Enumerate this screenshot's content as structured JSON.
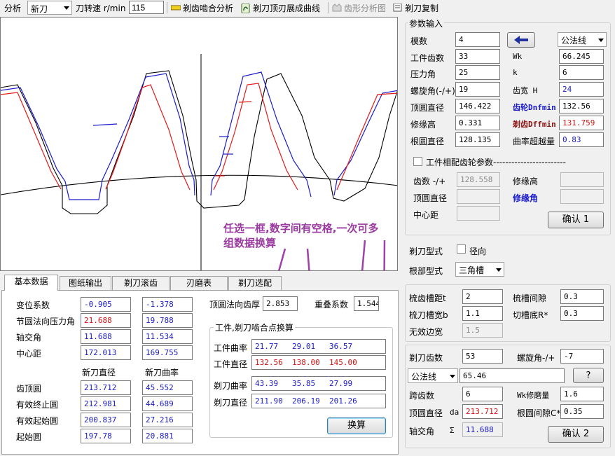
{
  "toolbar": {
    "analysis_label": "分析",
    "mode_value": "新刀",
    "speed_label": "刀转速 r/min",
    "speed_value": "115",
    "mesh_btn": "剃齿啮合分析",
    "tip_curve_btn": "剃刀顶刃展成曲线",
    "tooth_shape_btn": "齿形分析图",
    "copy_btn": "剃刀复制"
  },
  "canvas": {
    "annotation_line1": "任选一框,数字间有空格,一次可多",
    "annotation_line2": "组数据换算"
  },
  "tabs": [
    "基本数据",
    "图纸输出",
    "剃刀滚齿",
    "刃磨表",
    "剃刀选配"
  ],
  "basic": {
    "rows": [
      {
        "label": "变位系数",
        "a": "-0.905",
        "b": "-1.378"
      },
      {
        "label": "节圆法向压力角",
        "a": "21.688",
        "b": "19.788"
      },
      {
        "label": "轴交角",
        "a": "11.688",
        "b": "11.534"
      },
      {
        "label": "中心距",
        "a": "172.013",
        "b": "169.755"
      }
    ],
    "col_header_diameter": "新刀直径",
    "col_header_curvature": "新刀曲率",
    "circles": [
      {
        "label": "齿顶圆",
        "a": "213.712",
        "b": "45.552"
      },
      {
        "label": "有效终止圆",
        "a": "212.981",
        "b": "44.689"
      },
      {
        "label": "有效起始圆",
        "a": "200.837",
        "b": "27.216"
      },
      {
        "label": "起始圆",
        "a": "197.78",
        "b": "20.881"
      }
    ],
    "tip_thickness_label": "顶圆法向齿厚",
    "tip_thickness_value": "2.853",
    "overlap_label": "重叠系数",
    "overlap_value": "1.544",
    "mesh_group_title": "工件,剃刀啮合点换算",
    "wp_curvature_label": "工件曲率",
    "wp_curvature_value": "21.77   29.01   36.57",
    "wp_diameter_label": "工件直径",
    "wp_diameter_value": "132.56  138.00  145.00",
    "cutter_curvature_label": "剃刀曲率",
    "cutter_curvature_value": "43.39   35.85   27.99",
    "cutter_diameter_label": "剃刀直径",
    "cutter_diameter_value": "211.90  206.19  201.26",
    "convert_btn": "换算"
  },
  "params": {
    "title": "参数输入",
    "module_label": "模数",
    "module_value": "4",
    "teeth_label": "工件齿数",
    "teeth_value": "33",
    "pressure_label": "压力角",
    "pressure_value": "25",
    "helix_label": "螺旋角(-/+)",
    "helix_value": "19",
    "tip_label": "顶圆直径",
    "tip_value": "146.422",
    "edge_label": "修缘高",
    "edge_value": "0.331",
    "root_label": "根圆直径",
    "root_value": "128.135",
    "normal_select": "公法线",
    "wk_label": "Wk",
    "wk_value": "66.245",
    "k_label": "k",
    "k_value": "6",
    "width_label": "齿宽 H",
    "width_value": "24",
    "dnf_label": "齿轮Dnfmin",
    "dnf_value": "132.56",
    "dff_label": "剃齿Dffmin",
    "dff_value": "131.759",
    "overroll_label": "曲率超越量",
    "overroll_value": "0.83",
    "mate_check_label": "工件相配齿轮参数------------------------",
    "mate_teeth_label": "齿数 -/+",
    "mate_teeth_value": "128.558",
    "mate_tip_label": "顶圆直径",
    "mate_center_label": "中心距",
    "mate_edge_label": "修缘高",
    "mate_edgeangle_label": "修缘角",
    "confirm1": "确认 1"
  },
  "cutter": {
    "type_label": "剃刀型式",
    "radial_label": "径向",
    "root_type_label": "根部型式",
    "root_type_value": "三角槽",
    "comb_pitch_label": "梳齿槽距t",
    "comb_pitch_value": "2",
    "comb_gap_label": "梳槽间隙",
    "comb_gap_value": "0.3",
    "comb_width_label": "梳刀槽宽b",
    "comb_width_value": "1.1",
    "groove_label": "切槽底R*",
    "groove_value": "0.3",
    "invalid_label": "无效边宽",
    "invalid_value": "1.5",
    "teeth_label": "剃刀齿数",
    "teeth_value": "53",
    "helix_label": "螺旋角-/+",
    "helix_value": "-7",
    "normal_select": "公法线",
    "normal_value": "65.46",
    "help_btn": "?",
    "span_label": "跨齿数",
    "span_value": "6",
    "wk_fix_label": "Wk修磨量",
    "wk_fix_value": "1.6",
    "tip_label": "顶圆直径",
    "tip_sym": "da",
    "tip_value": "213.712",
    "root_gap_label": "根圆间隙C*",
    "root_gap_value": "0.35",
    "axis_label": "轴交角",
    "axis_sym": "Σ",
    "axis_value": "11.688",
    "confirm2": "确认 2"
  }
}
